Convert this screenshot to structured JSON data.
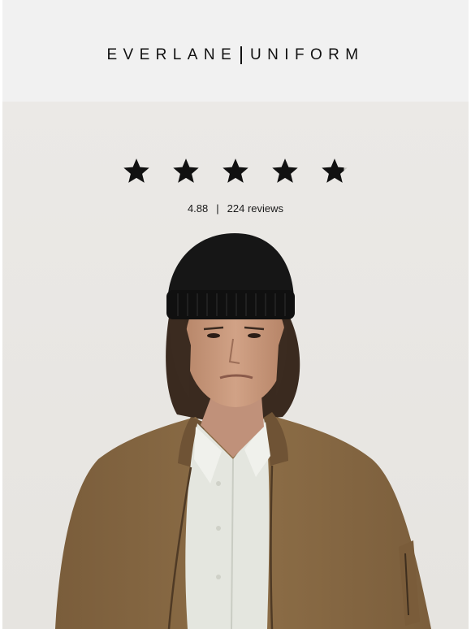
{
  "header": {
    "brand_left": "EVERLANE",
    "brand_right": "UNIFORM"
  },
  "hero": {
    "rating_value": "4.88",
    "separator": "|",
    "review_count": "224 reviews",
    "stars_filled": 4.88,
    "stars_total": 5,
    "background_color": "#ebe9e6",
    "photo": {
      "subject": "model-portrait",
      "beanie_color": "#141414",
      "jacket_color": "#8a6b45",
      "shirt_color": "#e4e6df"
    }
  },
  "colors": {
    "header_bg": "#f1f1f1",
    "text": "#111111",
    "star": "#111111"
  }
}
